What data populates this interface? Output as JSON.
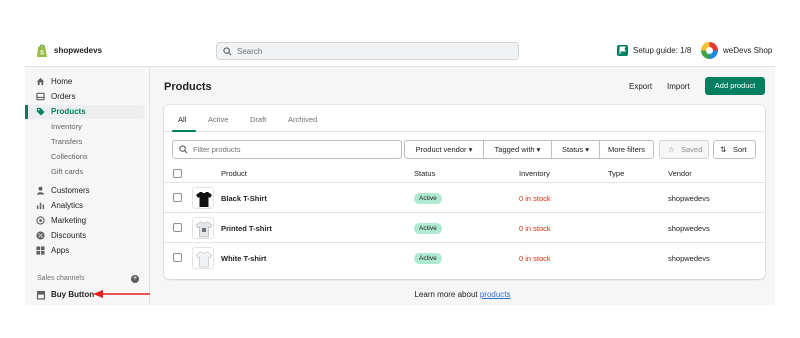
{
  "topbar": {
    "store_short": "shopwedevs",
    "search_placeholder": "Search",
    "setup_guide": "Setup guide: 1/8",
    "store_name": "weDevs Shop"
  },
  "sidebar": {
    "items": [
      {
        "label": "Home",
        "icon": "home-icon"
      },
      {
        "label": "Orders",
        "icon": "orders-icon"
      },
      {
        "label": "Products",
        "icon": "tag-icon",
        "active": true
      },
      {
        "label": "Inventory"
      },
      {
        "label": "Transfers"
      },
      {
        "label": "Collections"
      },
      {
        "label": "Gift cards"
      },
      {
        "label": "Customers",
        "icon": "person-icon"
      },
      {
        "label": "Analytics",
        "icon": "bar-chart-icon"
      },
      {
        "label": "Marketing",
        "icon": "target-icon"
      },
      {
        "label": "Discounts",
        "icon": "discount-icon"
      },
      {
        "label": "Apps",
        "icon": "apps-icon"
      }
    ],
    "sales_channels_label": "Sales channels",
    "buy_button_label": "Buy Button"
  },
  "header": {
    "title": "Products",
    "export": "Export",
    "import": "Import",
    "add_product": "Add product"
  },
  "tabs": [
    "All",
    "Active",
    "Draft",
    "Archived"
  ],
  "filters": {
    "placeholder": "Filter products",
    "vendor": "Product vendor",
    "tagged": "Tagged with",
    "status": "Status",
    "more": "More filters",
    "saved": "Saved",
    "sort": "Sort"
  },
  "table": {
    "columns": [
      "Product",
      "Status",
      "Inventory",
      "Type",
      "Vendor"
    ],
    "rows": [
      {
        "product": "Black T-Shirt",
        "status": "Active",
        "inventory": "0 in stock",
        "type": "",
        "vendor": "shopwedevs"
      },
      {
        "product": "Printed T-shirt",
        "status": "Active",
        "inventory": "0 in stock",
        "type": "",
        "vendor": "shopwedevs"
      },
      {
        "product": "White T-shirt",
        "status": "Active",
        "inventory": "0 in stock",
        "type": "",
        "vendor": "shopwedevs"
      }
    ]
  },
  "footer": {
    "learn_prefix": "Learn more about ",
    "learn_link": "products"
  },
  "colors": {
    "accent": "#008060",
    "danger": "#d72c0d",
    "badge_active": "#aee9d1",
    "link": "#2c6ecb",
    "annotation_arrow": "#e02020"
  }
}
